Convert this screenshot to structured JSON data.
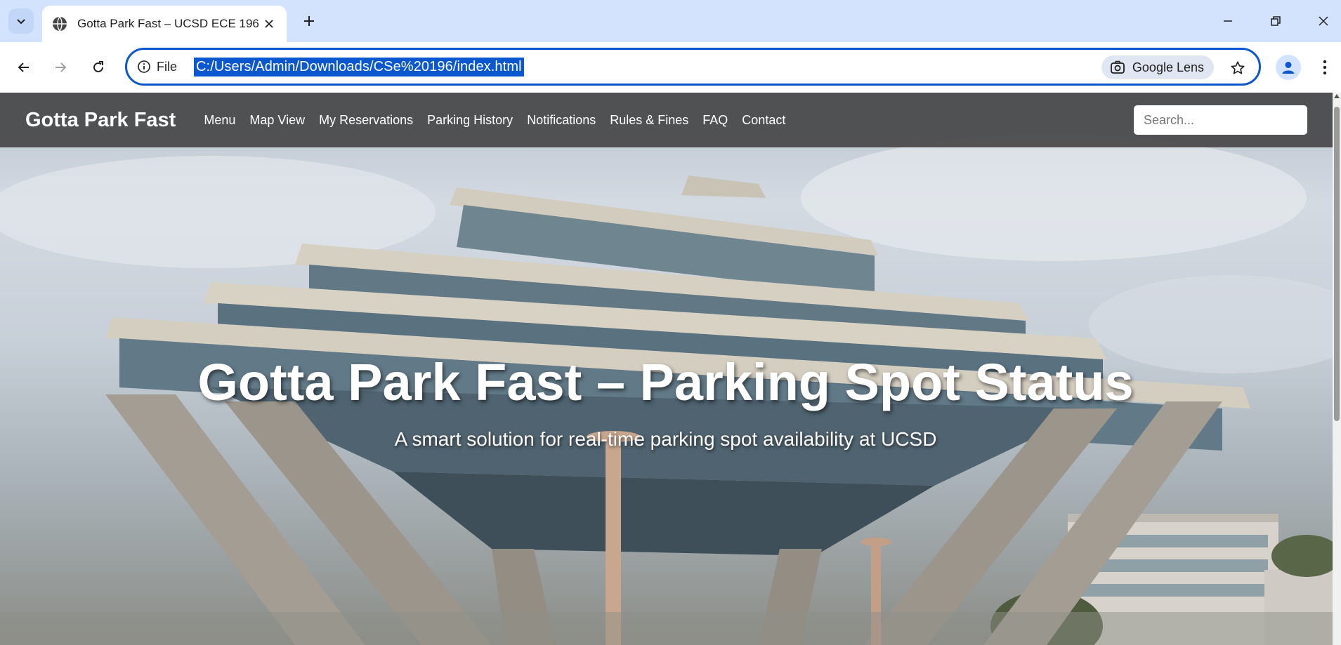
{
  "browser": {
    "tab_title": "Gotta Park Fast – UCSD ECE 196",
    "address_scheme_label": "File",
    "url": "C:/Users/Admin/Downloads/CSe%20196/index.html",
    "lens_label": "Google Lens",
    "icons": [
      "chevron-down-icon",
      "globe-icon",
      "close-icon",
      "plus-icon",
      "minimize-icon",
      "restore-icon",
      "close-window-icon",
      "back-arrow-icon",
      "forward-arrow-icon",
      "reload-icon",
      "info-icon",
      "lens-icon",
      "star-icon",
      "profile-icon",
      "kebab-menu-icon"
    ]
  },
  "site": {
    "brand": "Gotta Park Fast",
    "nav": [
      {
        "label": "Menu"
      },
      {
        "label": "Map View"
      },
      {
        "label": "My Reservations"
      },
      {
        "label": "Parking History"
      },
      {
        "label": "Notifications"
      },
      {
        "label": "Rules & Fines"
      },
      {
        "label": "FAQ"
      },
      {
        "label": "Contact"
      }
    ],
    "search_placeholder": "Search..."
  },
  "hero": {
    "title": "Gotta Park Fast – Parking Spot Status",
    "subtitle": "A smart solution for real-time parking spot availability at UCSD"
  },
  "colors": {
    "tabbar_bg": "#d3e3fd",
    "omnibox_border": "#0b57d0",
    "site_nav_bg": "#464648"
  }
}
